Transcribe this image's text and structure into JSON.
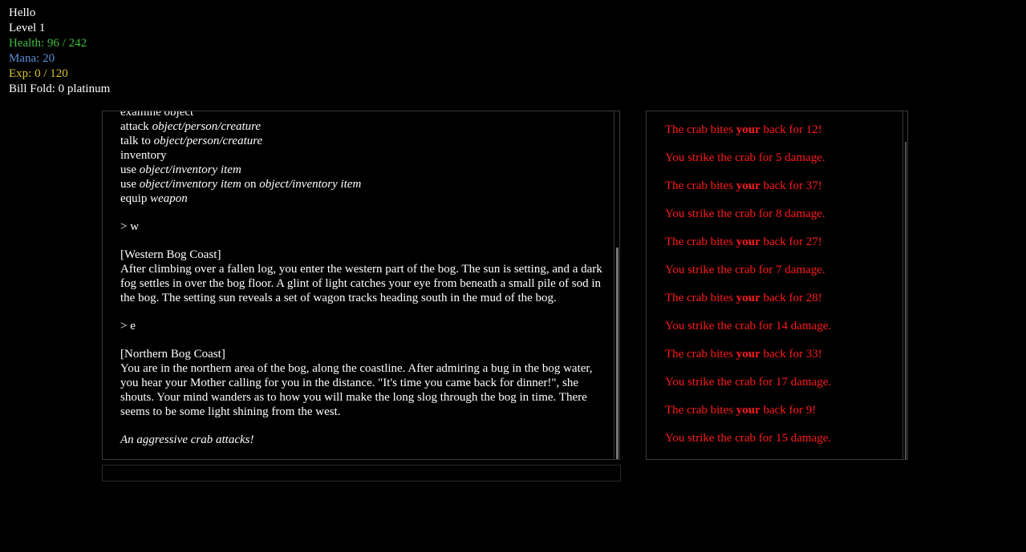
{
  "stats": {
    "greeting": "Hello",
    "level": "Level 1",
    "health": "Health: 96 / 242",
    "mana": "Mana: 20",
    "exp": "Exp: 0 / 120",
    "billfold": "Bill Fold: 0 platinum"
  },
  "story": {
    "cut_line": "examine object",
    "commands": [
      {
        "verb": "attack ",
        "arg": "object/person/creature",
        "mid": "",
        "arg2": ""
      },
      {
        "verb": "talk to ",
        "arg": "object/person/creature",
        "mid": "",
        "arg2": ""
      },
      {
        "verb": "inventory",
        "arg": "",
        "mid": "",
        "arg2": ""
      },
      {
        "verb": "use ",
        "arg": "object/inventory item",
        "mid": "",
        "arg2": ""
      },
      {
        "verb": "use ",
        "arg": "object/inventory item",
        "mid": " on ",
        "arg2": "object/inventory item"
      },
      {
        "verb": "equip ",
        "arg": "weapon",
        "mid": "",
        "arg2": ""
      }
    ],
    "cmd1": "> w",
    "room1_title": "[Western Bog Coast]",
    "room1_desc": "After climbing over a fallen log, you enter the western part of the bog. The sun is setting, and a dark fog settles in over the bog floor. A glint of light catches your eye from beneath a small pile of sod in the bog. The setting sun reveals a set of wagon tracks heading south in the mud of the bog.",
    "cmd2": "> e",
    "room2_title": "[Northern Bog Coast]",
    "room2_desc": "You are in the northern area of the bog, along the coastline. After admiring a bug in the bog water, you hear your Mother calling for you in the distance. \"It's time you came back for dinner!\", she shouts. Your mind wanders as to how you will make the long slog through the bog in time. There seems to be some light shining from the west.",
    "event": "An aggressive crab attacks!"
  },
  "combat": [
    {
      "pre": "The crab bites ",
      "bold": "your",
      "post": " back for 12!"
    },
    {
      "pre": "You strike the crab for 5 damage.",
      "bold": "",
      "post": ""
    },
    {
      "pre": "The crab bites ",
      "bold": "your",
      "post": " back for 37!"
    },
    {
      "pre": "You strike the crab for 8 damage.",
      "bold": "",
      "post": ""
    },
    {
      "pre": "The crab bites ",
      "bold": "your",
      "post": " back for 27!"
    },
    {
      "pre": "You strike the crab for 7 damage.",
      "bold": "",
      "post": ""
    },
    {
      "pre": "The crab bites ",
      "bold": "your",
      "post": " back for 28!"
    },
    {
      "pre": "You strike the crab for 14 damage.",
      "bold": "",
      "post": ""
    },
    {
      "pre": "The crab bites ",
      "bold": "your",
      "post": " back for 33!"
    },
    {
      "pre": "You strike the crab for 17 damage.",
      "bold": "",
      "post": ""
    },
    {
      "pre": "The crab bites ",
      "bold": "your",
      "post": " back for 9!"
    },
    {
      "pre": "You strike the crab for 15 damage.",
      "bold": "",
      "post": ""
    }
  ],
  "input": {
    "value": ""
  },
  "colors": {
    "health": "#3fbf3f",
    "mana": "#5b8fd6",
    "exp": "#d6c42a",
    "combat": "#ff1a1a"
  }
}
